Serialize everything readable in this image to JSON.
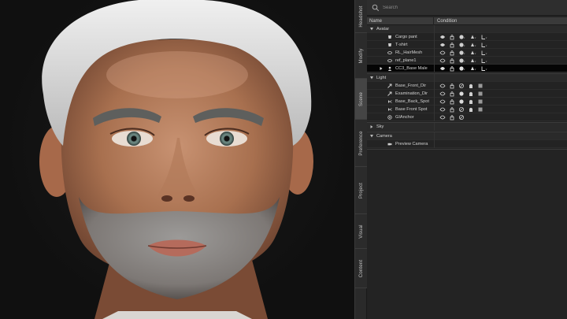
{
  "tabs": [
    {
      "label": "Headshot",
      "active": false
    },
    {
      "label": "Modify",
      "active": false
    },
    {
      "label": "Scene",
      "active": true
    },
    {
      "label": "Preference",
      "active": false
    },
    {
      "label": "Project",
      "active": false
    },
    {
      "label": "Visual",
      "active": false
    },
    {
      "label": "Content",
      "active": false
    }
  ],
  "search": {
    "placeholder": "Search"
  },
  "columns": {
    "name": "Name",
    "condition": "Condition"
  },
  "tree": {
    "avatar": {
      "label": "Avatar",
      "items": [
        {
          "label": "Cargo pant",
          "icon": "garment-icon"
        },
        {
          "label": "T-shirt",
          "icon": "garment-icon"
        },
        {
          "label": "RL_HairMesh",
          "icon": "mesh-icon"
        },
        {
          "label": "ref_plane1",
          "icon": "mesh-icon"
        },
        {
          "label": "CC3_Base Male",
          "icon": "avatar-icon",
          "selected": true
        }
      ]
    },
    "light": {
      "label": "Light",
      "items": [
        {
          "label": "Base_Front_Dir",
          "icon": "light-icon"
        },
        {
          "label": "Examination_Dir",
          "icon": "light-icon"
        },
        {
          "label": "Base_Back_Spot",
          "icon": "spot-light-icon"
        },
        {
          "label": "Base Front Spot",
          "icon": "spot-light-icon"
        },
        {
          "label": "GIAnchor",
          "icon": "gi-anchor-icon"
        }
      ]
    },
    "sky": {
      "label": "Sky"
    },
    "camera": {
      "label": "Camera",
      "items": [
        {
          "label": "Preview Camera",
          "icon": "camera-icon"
        }
      ]
    }
  },
  "colors": {
    "panel_bg": "#232323",
    "selected_row": "#050505",
    "text": "#d2d2d2"
  }
}
